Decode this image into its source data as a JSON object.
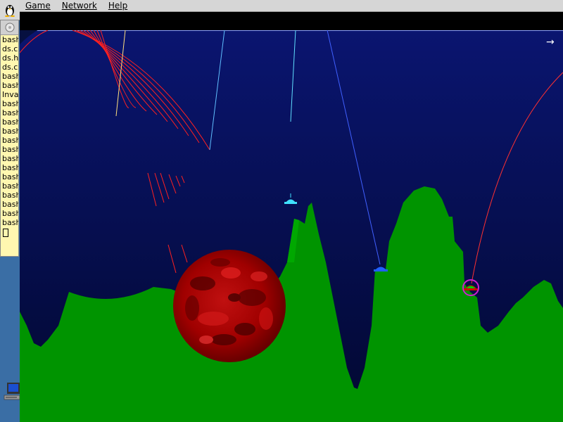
{
  "menu": {
    "items": [
      {
        "label": "Game"
      },
      {
        "label": "Network"
      },
      {
        "label": "Help"
      }
    ]
  },
  "taskbar": {
    "items": [
      "bash",
      "ds.c",
      "ds.h",
      "ds.c",
      "bash",
      "bash",
      "Inva",
      "bash",
      "bash",
      "bash",
      "bash",
      "bash",
      "bash",
      "bash",
      "bash",
      "bash",
      "bash",
      "bash",
      "bash",
      "bash",
      "bash"
    ]
  },
  "game": {
    "wind_indicator": "→",
    "colors": {
      "sky_top": "#0a1570",
      "sky_bottom": "#020830",
      "terrain": "#009400",
      "planet": "#b00000",
      "trajectory": "#ff2020",
      "target_ring": "#d020d0"
    }
  }
}
